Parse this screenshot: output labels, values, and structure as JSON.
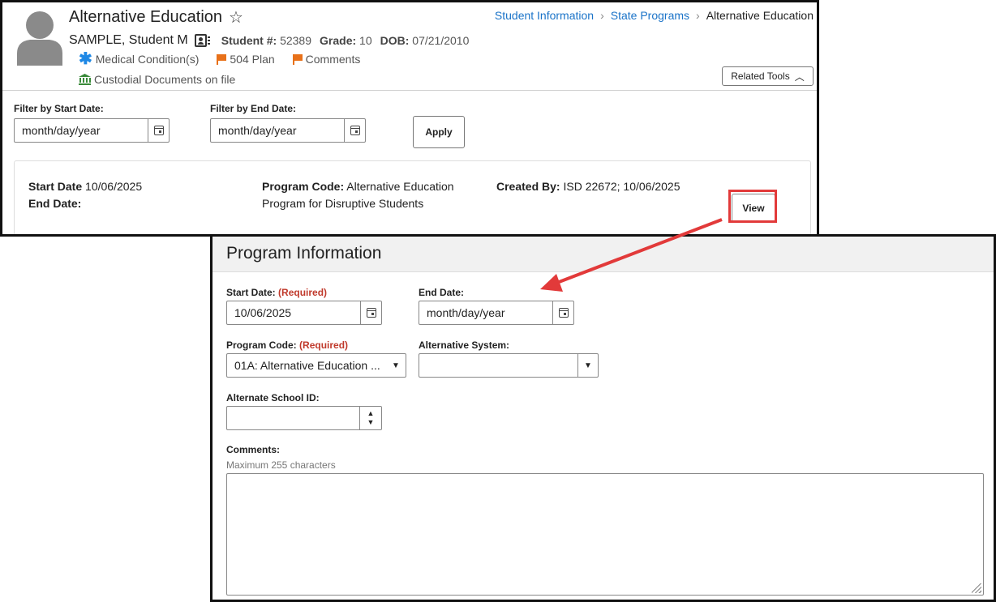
{
  "header": {
    "page_title": "Alternative Education",
    "breadcrumb": [
      "Student Information",
      "State Programs",
      "Alternative Education"
    ],
    "student_name": "SAMPLE, Student M",
    "student_number_label": "Student #:",
    "student_number": "52389",
    "grade_label": "Grade:",
    "grade": "10",
    "dob_label": "DOB:",
    "dob": "07/21/2010",
    "flags": [
      "Medical Condition(s)",
      "504 Plan",
      "Comments"
    ],
    "custodial": "Custodial Documents on file",
    "related_tools": "Related Tools"
  },
  "filters": {
    "start_label": "Filter by Start Date:",
    "start_placeholder": "month/day/year",
    "end_label": "Filter by End Date:",
    "end_placeholder": "month/day/year",
    "apply": "Apply"
  },
  "record": {
    "start_date_label": "Start Date",
    "start_date": "10/06/2025",
    "end_date_label": "End Date:",
    "end_date": "",
    "program_code_label": "Program Code:",
    "program_code_line1": "Alternative Education",
    "program_code_line2": "Program for Disruptive Students",
    "created_by_label": "Created By:",
    "created_by": "ISD 22672; 10/06/2025",
    "view": "View"
  },
  "program_info": {
    "title": "Program Information",
    "start_date_label": "Start Date:",
    "required": "(Required)",
    "start_date_value": "10/06/2025",
    "end_date_label": "End Date:",
    "end_date_placeholder": "month/day/year",
    "program_code_label": "Program Code:",
    "program_code_value": "01A: Alternative Education ...",
    "alt_system_label": "Alternative System:",
    "alt_system_value": "",
    "alt_school_label": "Alternate School ID:",
    "comments_label": "Comments:",
    "comments_hint": "Maximum 255 characters"
  },
  "colors": {
    "link": "#1a73c8",
    "required": "#c0392b",
    "highlight": "#e23a3a",
    "flag": "#e8711a",
    "asterisk": "#1e88e5"
  }
}
